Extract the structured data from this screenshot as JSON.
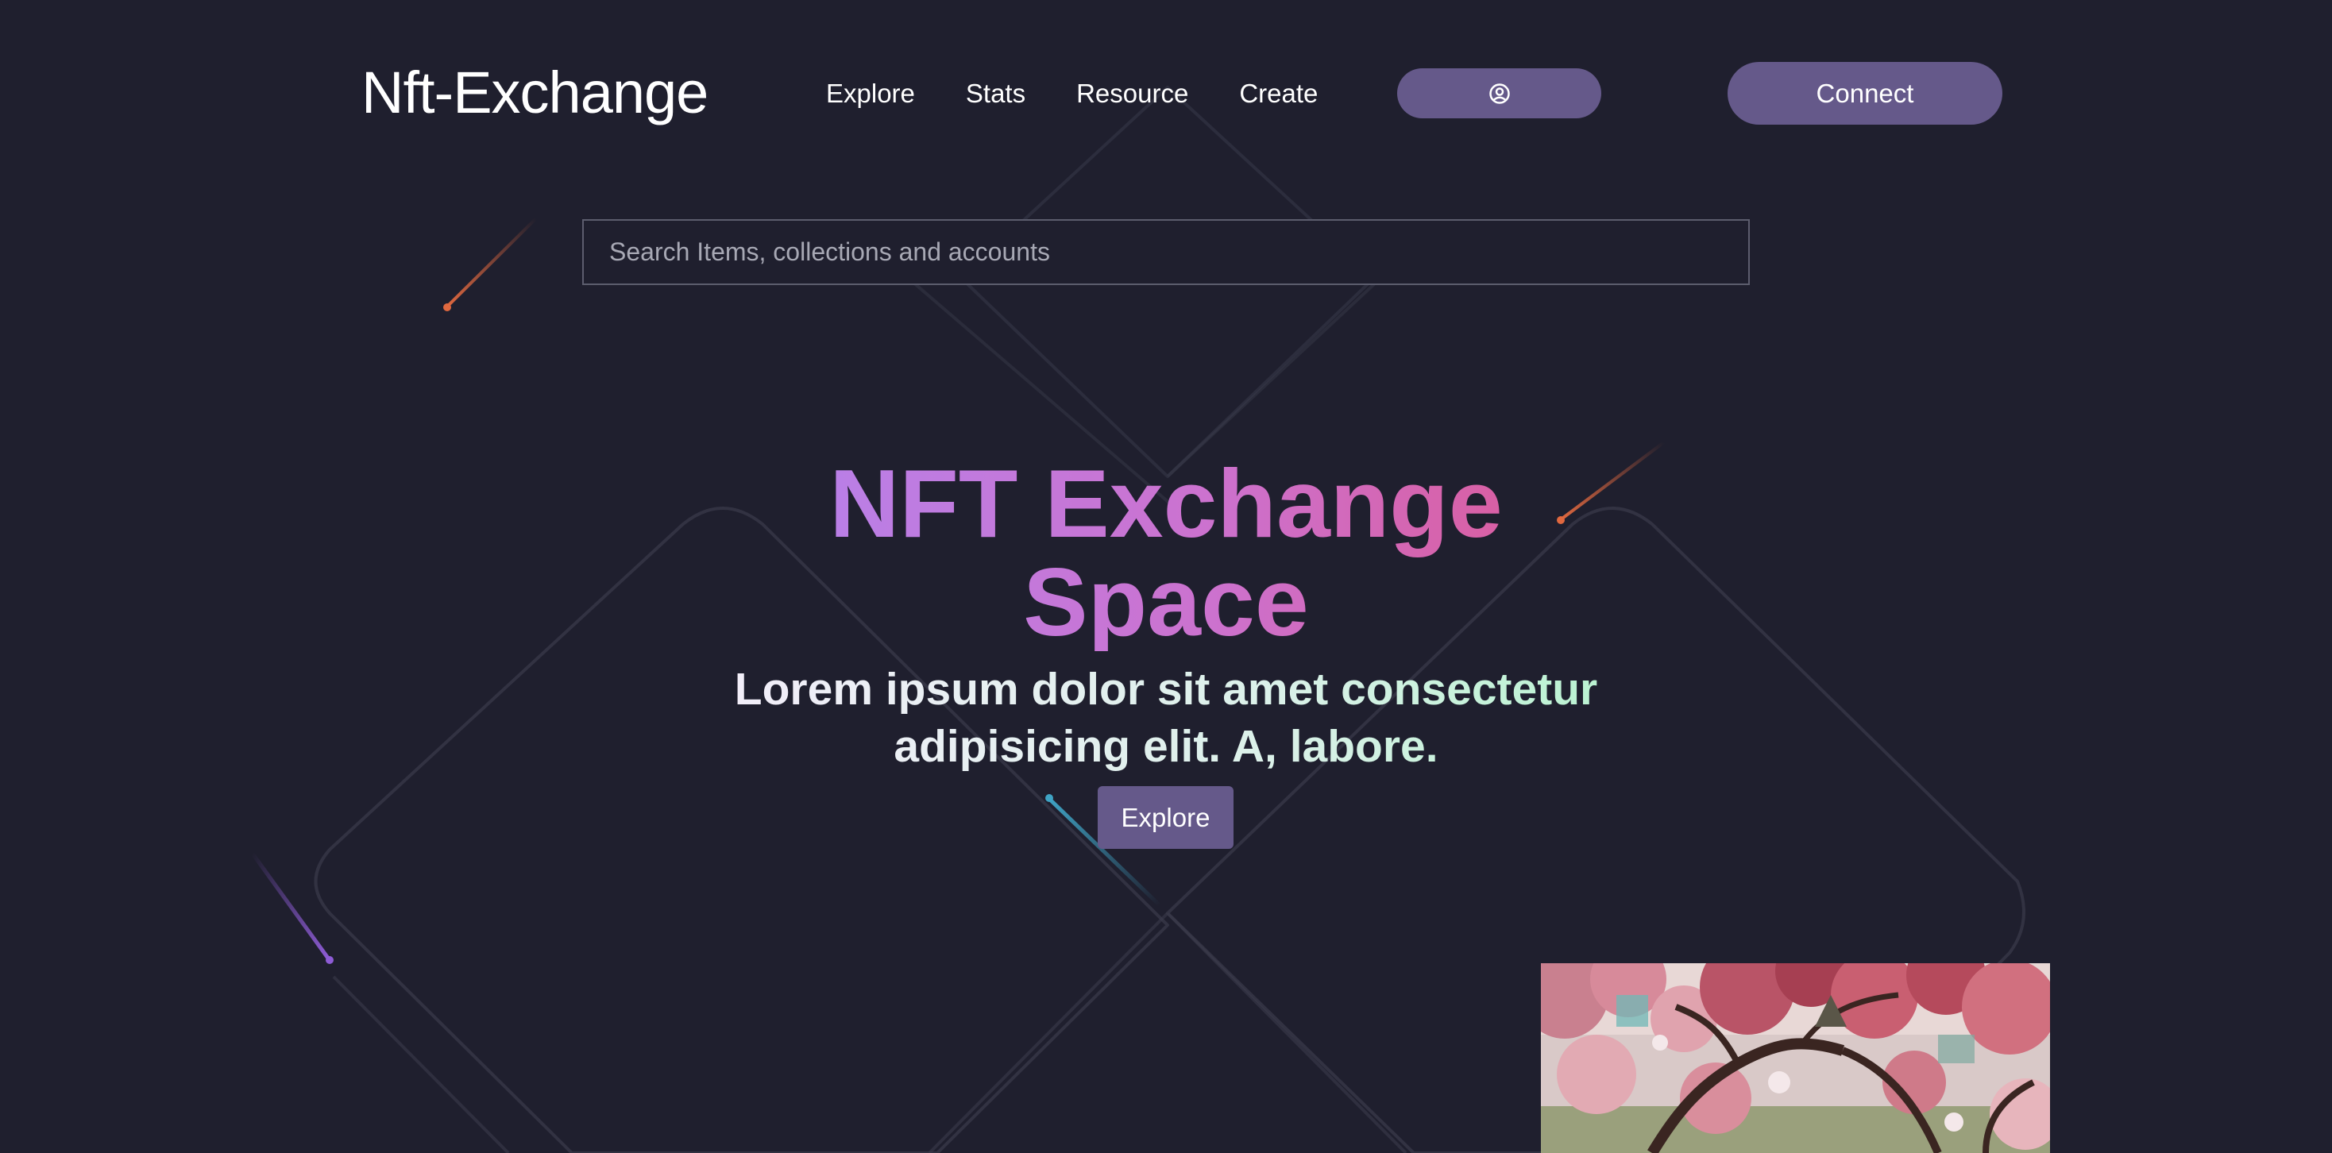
{
  "header": {
    "logo": "Nft-Exchange",
    "nav": [
      "Explore",
      "Stats",
      "Resource",
      "Create"
    ],
    "account_icon": "user-circle-icon",
    "connect_label": "Connect"
  },
  "search": {
    "placeholder": "Search Items, collections and accounts"
  },
  "hero": {
    "title": "NFT Exchange Space",
    "subtitle": "Lorem ipsum dolor sit amet consectetur adipisicing elit. A, labore.",
    "cta_label": "Explore"
  },
  "artwork": {
    "subject": "cherry-blossom-tree-painting"
  },
  "colors": {
    "background": "#1f1f2e",
    "button": "#65598a",
    "title_gradient_start": "#b781ea",
    "title_gradient_end": "#db5c9c",
    "subtitle_gradient_end": "#b8f2d0",
    "meteor_orange": "#e0683f",
    "meteor_purple": "#8e5cd6",
    "meteor_cyan": "#3fa3c4"
  }
}
